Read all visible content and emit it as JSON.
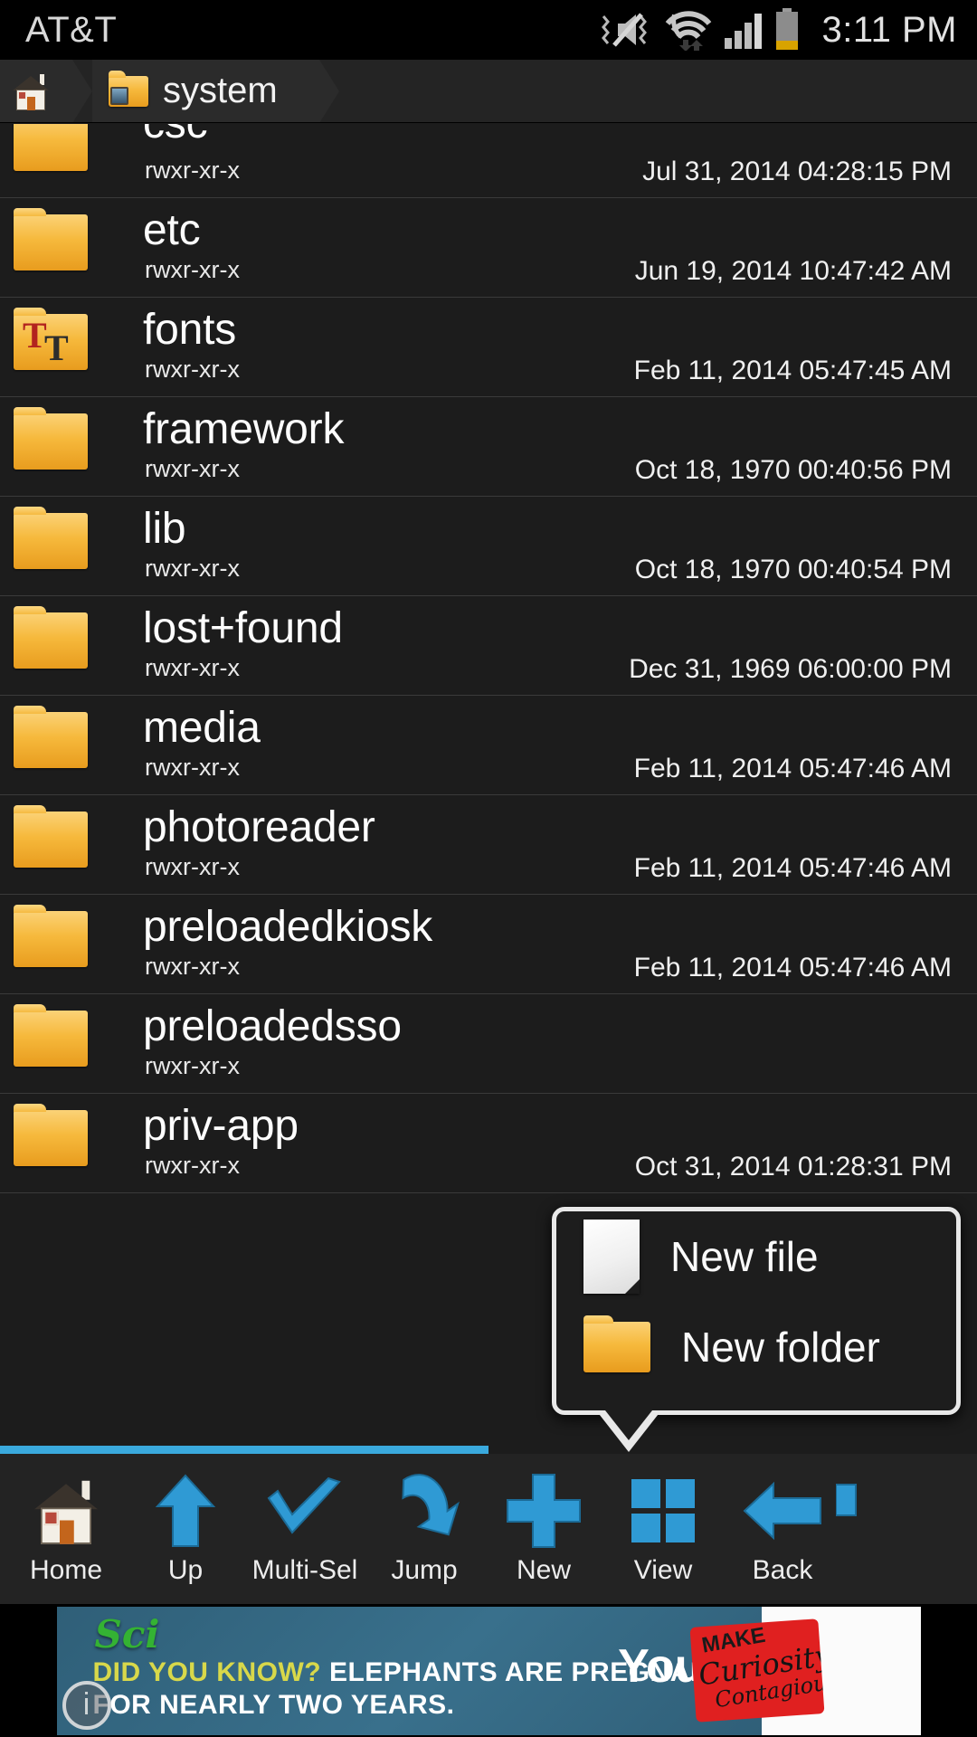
{
  "status_bar": {
    "carrier": "AT&T",
    "time": "3:11 PM",
    "icons": [
      "mute-vibrate-icon",
      "wifi-icon",
      "signal-icon",
      "battery-icon"
    ]
  },
  "breadcrumb": {
    "home_icon": "home-icon",
    "current_icon": "system-folder-icon",
    "current_label": "system"
  },
  "file_list": [
    {
      "name": "csc",
      "permissions": "rwxr-xr-x",
      "date": "Jul 31, 2014 04:28:15 PM",
      "icon": "folder-icon"
    },
    {
      "name": "etc",
      "permissions": "rwxr-xr-x",
      "date": "Jun 19, 2014 10:47:42 AM",
      "icon": "folder-icon"
    },
    {
      "name": "fonts",
      "permissions": "rwxr-xr-x",
      "date": "Feb 11, 2014 05:47:45 AM",
      "icon": "fonts-folder-icon"
    },
    {
      "name": "framework",
      "permissions": "rwxr-xr-x",
      "date": "Oct 18, 1970 00:40:56 PM",
      "icon": "folder-icon"
    },
    {
      "name": "lib",
      "permissions": "rwxr-xr-x",
      "date": "Oct 18, 1970 00:40:54 PM",
      "icon": "folder-icon"
    },
    {
      "name": "lost+found",
      "permissions": "rwxr-xr-x",
      "date": "Dec 31, 1969 06:00:00 PM",
      "icon": "folder-icon"
    },
    {
      "name": "media",
      "permissions": "rwxr-xr-x",
      "date": "Feb 11, 2014 05:47:46 AM",
      "icon": "folder-icon"
    },
    {
      "name": "photoreader",
      "permissions": "rwxr-xr-x",
      "date": "Feb 11, 2014 05:47:46 AM",
      "icon": "folder-icon"
    },
    {
      "name": "preloadedkiosk",
      "permissions": "rwxr-xr-x",
      "date": "Feb 11, 2014 05:47:46 AM",
      "icon": "folder-icon"
    },
    {
      "name": "preloadedsso",
      "permissions": "rwxr-xr-x",
      "date": "",
      "icon": "folder-icon"
    },
    {
      "name": "priv-app",
      "permissions": "rwxr-xr-x",
      "date": "Oct 31, 2014 01:28:31 PM",
      "icon": "folder-icon"
    }
  ],
  "popup_menu": {
    "items": [
      {
        "label": "New file",
        "icon": "document-icon"
      },
      {
        "label": "New folder",
        "icon": "folder-icon"
      }
    ]
  },
  "toolbar": {
    "items": [
      {
        "label": "Home",
        "icon": "home-icon"
      },
      {
        "label": "Up",
        "icon": "arrow-up-icon"
      },
      {
        "label": "Multi-Sel",
        "icon": "checkmark-icon"
      },
      {
        "label": "Jump",
        "icon": "jump-arrow-icon"
      },
      {
        "label": "New",
        "icon": "plus-icon"
      },
      {
        "label": "View",
        "icon": "grid-icon"
      },
      {
        "label": "Back",
        "icon": "arrow-left-icon"
      }
    ],
    "scroll_percent": 50,
    "accent_color": "#3aa9dd"
  },
  "ad_banner": {
    "logo": "Sci",
    "line1_highlight": "DID YOU KNOW?",
    "line1_rest": " ELEPHANTS ARE PREGNANT",
    "line2": "FOR NEARLY TWO YEARS.",
    "brand": "You",
    "badge_line1": "MAKE",
    "badge_line2": "Curiosity",
    "badge_line3": "Contagious",
    "info_glyph": "i"
  }
}
